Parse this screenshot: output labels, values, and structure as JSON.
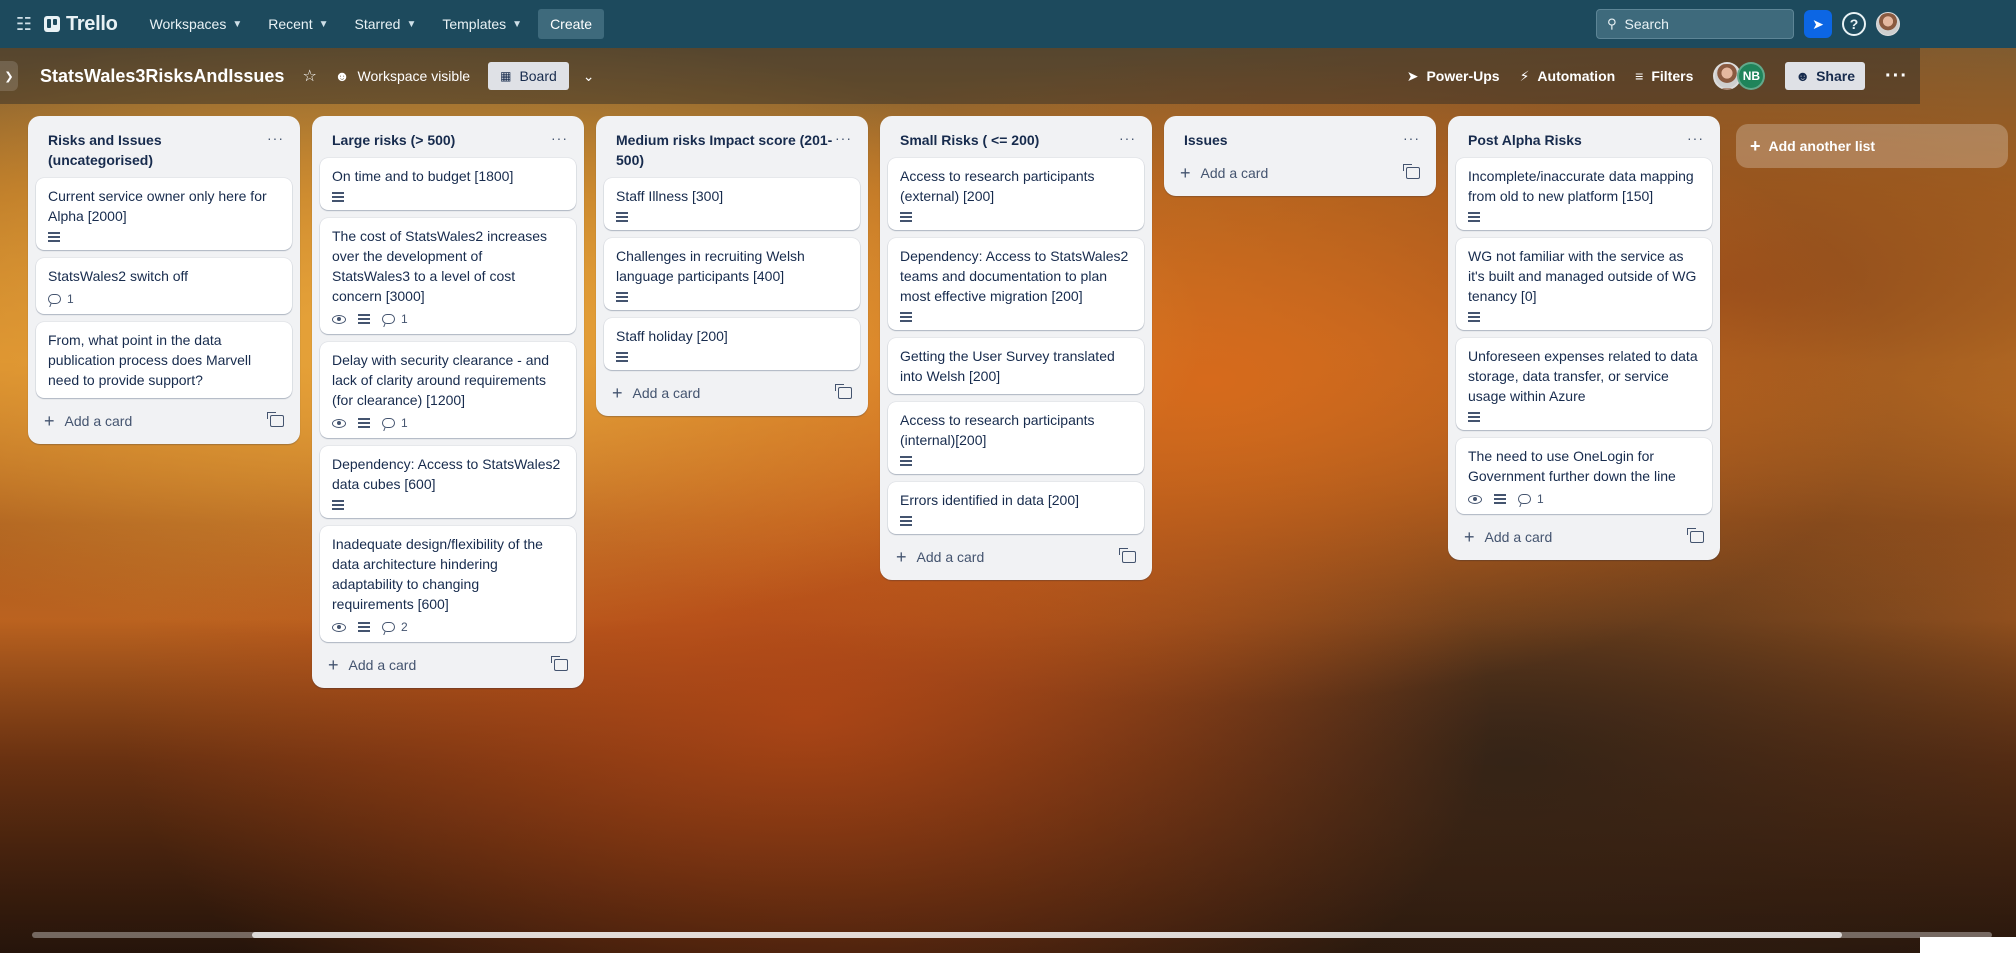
{
  "topbar": {
    "logo": "Trello",
    "nav": [
      {
        "label": "Workspaces"
      },
      {
        "label": "Recent"
      },
      {
        "label": "Starred"
      },
      {
        "label": "Templates"
      }
    ],
    "create_label": "Create",
    "search_placeholder": "Search"
  },
  "board": {
    "title": "StatsWales3RisksAndIssues",
    "visibility": "Workspace visible",
    "view_label": "Board",
    "powerups": "Power-Ups",
    "automation": "Automation",
    "filters": "Filters",
    "member_initials": "NB",
    "share": "Share"
  },
  "add_card_label": "Add a card",
  "add_list_label": "Add another list",
  "lists": [
    {
      "title": "Risks and Issues (uncategorised)",
      "cards": [
        {
          "title": "Current service owner only here for Alpha [2000]",
          "watch": false,
          "desc": true,
          "comments": ""
        },
        {
          "title": "StatsWales2 switch off",
          "watch": false,
          "desc": false,
          "comments": "1"
        },
        {
          "title": "From, what point in the data publication process does Marvell need to provide support?",
          "watch": false,
          "desc": false,
          "comments": ""
        }
      ]
    },
    {
      "title": "Large risks (> 500)",
      "cards": [
        {
          "title": "On time and to budget [1800]",
          "watch": false,
          "desc": true,
          "comments": ""
        },
        {
          "title": "The cost of StatsWales2 increases over the development of StatsWales3 to a level of cost concern [3000]",
          "watch": true,
          "desc": true,
          "comments": "1"
        },
        {
          "title": "Delay with security clearance - and lack of clarity around requirements (for clearance) [1200]",
          "watch": true,
          "desc": true,
          "comments": "1"
        },
        {
          "title": "Dependency: Access to StatsWales2 data cubes [600]",
          "watch": false,
          "desc": true,
          "comments": ""
        },
        {
          "title": "Inadequate design/flexibility of the data architecture hindering adaptability to changing requirements [600]",
          "watch": true,
          "desc": true,
          "comments": "2"
        }
      ]
    },
    {
      "title": "Medium risks Impact score (201-500)",
      "cards": [
        {
          "title": "Staff Illness [300]",
          "watch": false,
          "desc": true,
          "comments": ""
        },
        {
          "title": "Challenges in recruiting Welsh language participants [400]",
          "watch": false,
          "desc": true,
          "comments": ""
        },
        {
          "title": "Staff holiday [200]",
          "watch": false,
          "desc": true,
          "comments": ""
        }
      ]
    },
    {
      "title": "Small Risks ( <= 200)",
      "cards": [
        {
          "title": "Access to research participants (external) [200]",
          "watch": false,
          "desc": true,
          "comments": ""
        },
        {
          "title": "Dependency: Access to StatsWales2 teams and documentation to plan most effective migration [200]",
          "watch": false,
          "desc": true,
          "comments": ""
        },
        {
          "title": "Getting the User Survey translated into Welsh [200]",
          "watch": false,
          "desc": false,
          "comments": ""
        },
        {
          "title": "Access to research participants (internal)[200]",
          "watch": false,
          "desc": true,
          "comments": ""
        },
        {
          "title": "Errors identified in data [200]",
          "watch": false,
          "desc": true,
          "comments": ""
        }
      ]
    },
    {
      "title": "Issues",
      "cards": []
    },
    {
      "title": "Post Alpha Risks",
      "cards": [
        {
          "title": "Incomplete/inaccurate data mapping from old to new platform [150]",
          "watch": false,
          "desc": true,
          "comments": ""
        },
        {
          "title": "WG not familiar with the service as it's built and managed outside of WG tenancy [0]",
          "watch": false,
          "desc": true,
          "comments": ""
        },
        {
          "title": "Unforeseen expenses related to data storage, data transfer, or service usage within Azure",
          "watch": false,
          "desc": true,
          "comments": ""
        },
        {
          "title": "The need to use OneLogin for Government further down the line",
          "watch": true,
          "desc": true,
          "comments": "1"
        }
      ]
    }
  ]
}
